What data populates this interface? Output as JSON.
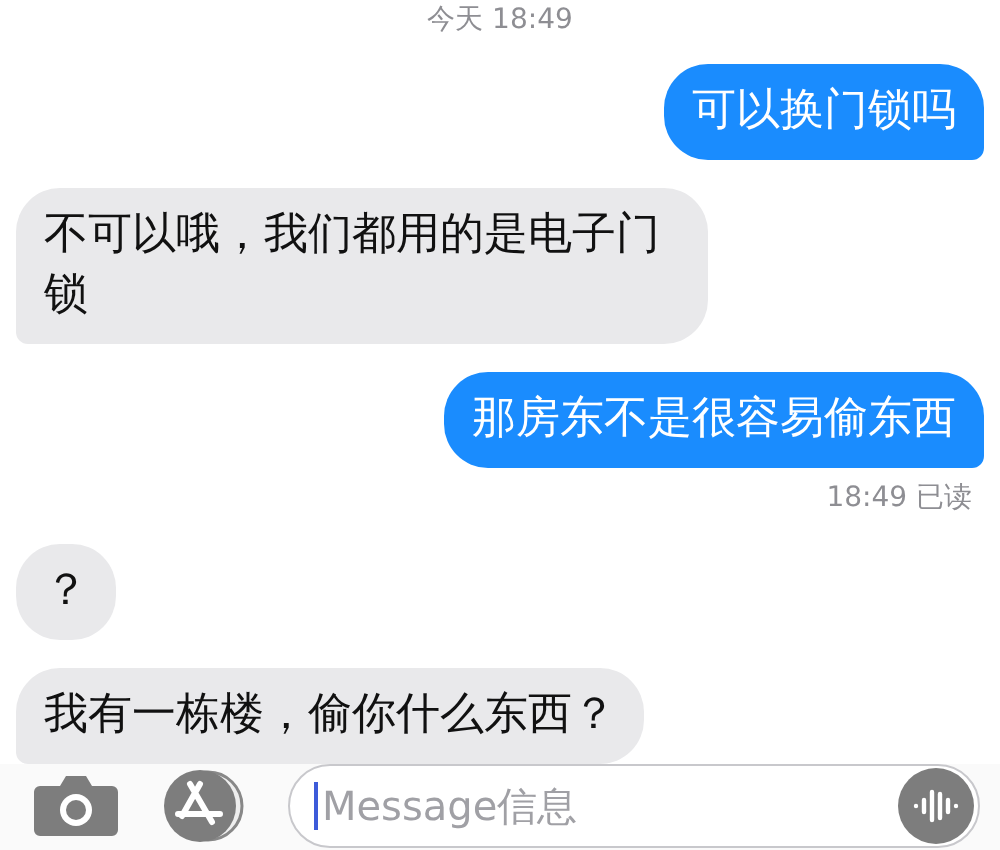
{
  "timestamp": "今天 18:49",
  "messages": [
    {
      "kind": "sent",
      "text": "可以换门锁吗",
      "tail": true
    },
    {
      "kind": "received",
      "text": "不可以哦，我们都用的是电子门锁",
      "tail": true
    },
    {
      "kind": "sent",
      "text": "那房东不是很容易偷东西",
      "tail": true
    },
    {
      "kind": "receipt",
      "text": "18:49 已读"
    },
    {
      "kind": "received",
      "text": "？",
      "tail": false
    },
    {
      "kind": "received",
      "text": "我有一栋楼，偷你什么东西？",
      "tail": true
    }
  ],
  "composer": {
    "placeholder": "Message信息"
  }
}
